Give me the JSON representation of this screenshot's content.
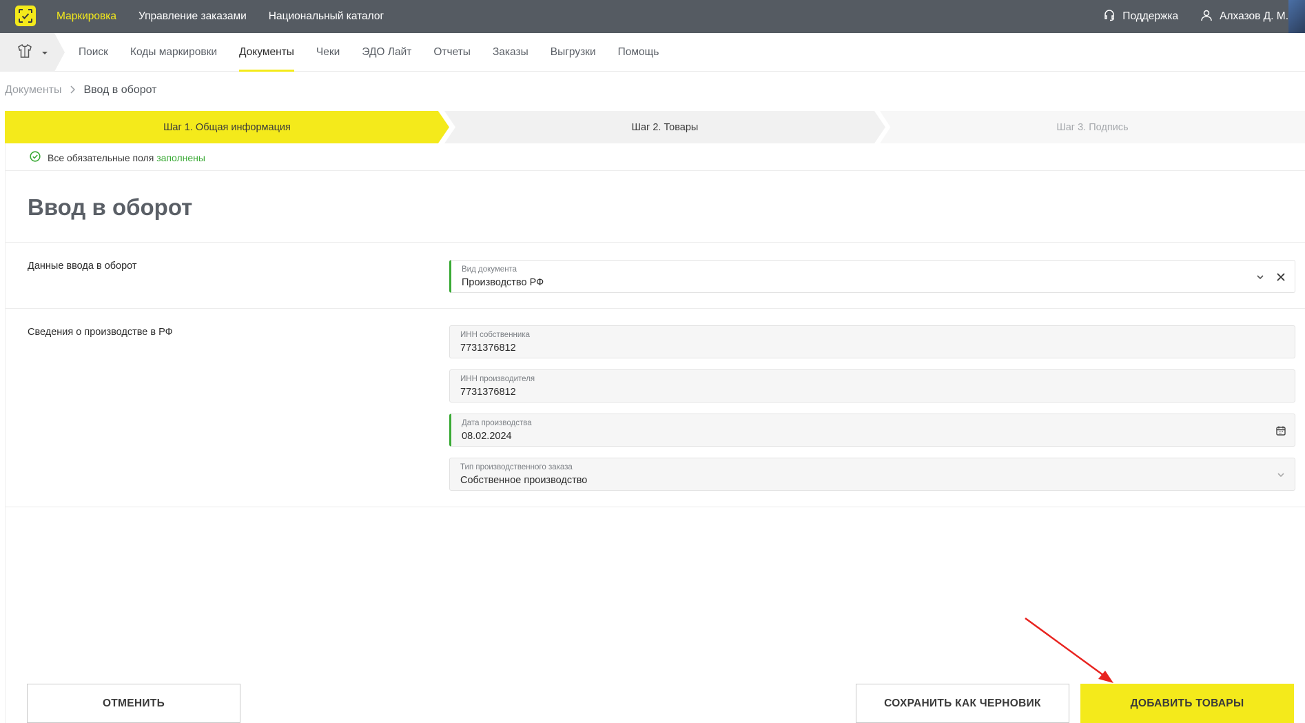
{
  "topbar": {
    "nav": [
      "Маркировка",
      "Управление заказами",
      "Национальный каталог"
    ],
    "support_label": "Поддержка",
    "user_label": "Алхазов Д. М.",
    "accent_color": "#f4ea1b",
    "icons": {
      "logo": "scan-logo-icon",
      "support": "headset-icon",
      "user": "user-icon"
    }
  },
  "subnav": {
    "tabs": [
      "Поиск",
      "Коды маркировки",
      "Документы",
      "Чеки",
      "ЭДО Лайт",
      "Отчеты",
      "Заказы",
      "Выгрузки",
      "Помощь"
    ],
    "active_tab": "Документы"
  },
  "breadcrumb": {
    "parent": "Документы",
    "current": "Ввод в оборот"
  },
  "steps": [
    {
      "label": "Шаг 1. Общая информация",
      "state": "active"
    },
    {
      "label": "Шаг 2. Товары",
      "state": "next"
    },
    {
      "label": "Шаг 3. Подпись",
      "state": "disabled"
    }
  ],
  "status": {
    "prefix": "Все обязательные поля",
    "highlight": "заполнены",
    "color": "#3aaa35"
  },
  "page_title": "Ввод в оборот",
  "sections": {
    "entry_data": {
      "label": "Данные ввода в оборот",
      "doc_type": {
        "label": "Вид документа",
        "value": "Производство РФ"
      }
    },
    "production": {
      "label": "Сведения о производстве в РФ",
      "owner_inn": {
        "label": "ИНН собственника",
        "value": "7731376812"
      },
      "producer_inn": {
        "label": "ИНН производителя",
        "value": "7731376812"
      },
      "production_date": {
        "label": "Дата производства",
        "value": "08.02.2024"
      },
      "order_type": {
        "label": "Тип производственного заказа",
        "value": "Собственное производство"
      }
    }
  },
  "buttons": {
    "cancel": "ОТМЕНИТЬ",
    "save_draft": "СОХРАНИТЬ КАК ЧЕРНОВИК",
    "add_goods": "ДОБАВИТЬ ТОВАРЫ"
  }
}
